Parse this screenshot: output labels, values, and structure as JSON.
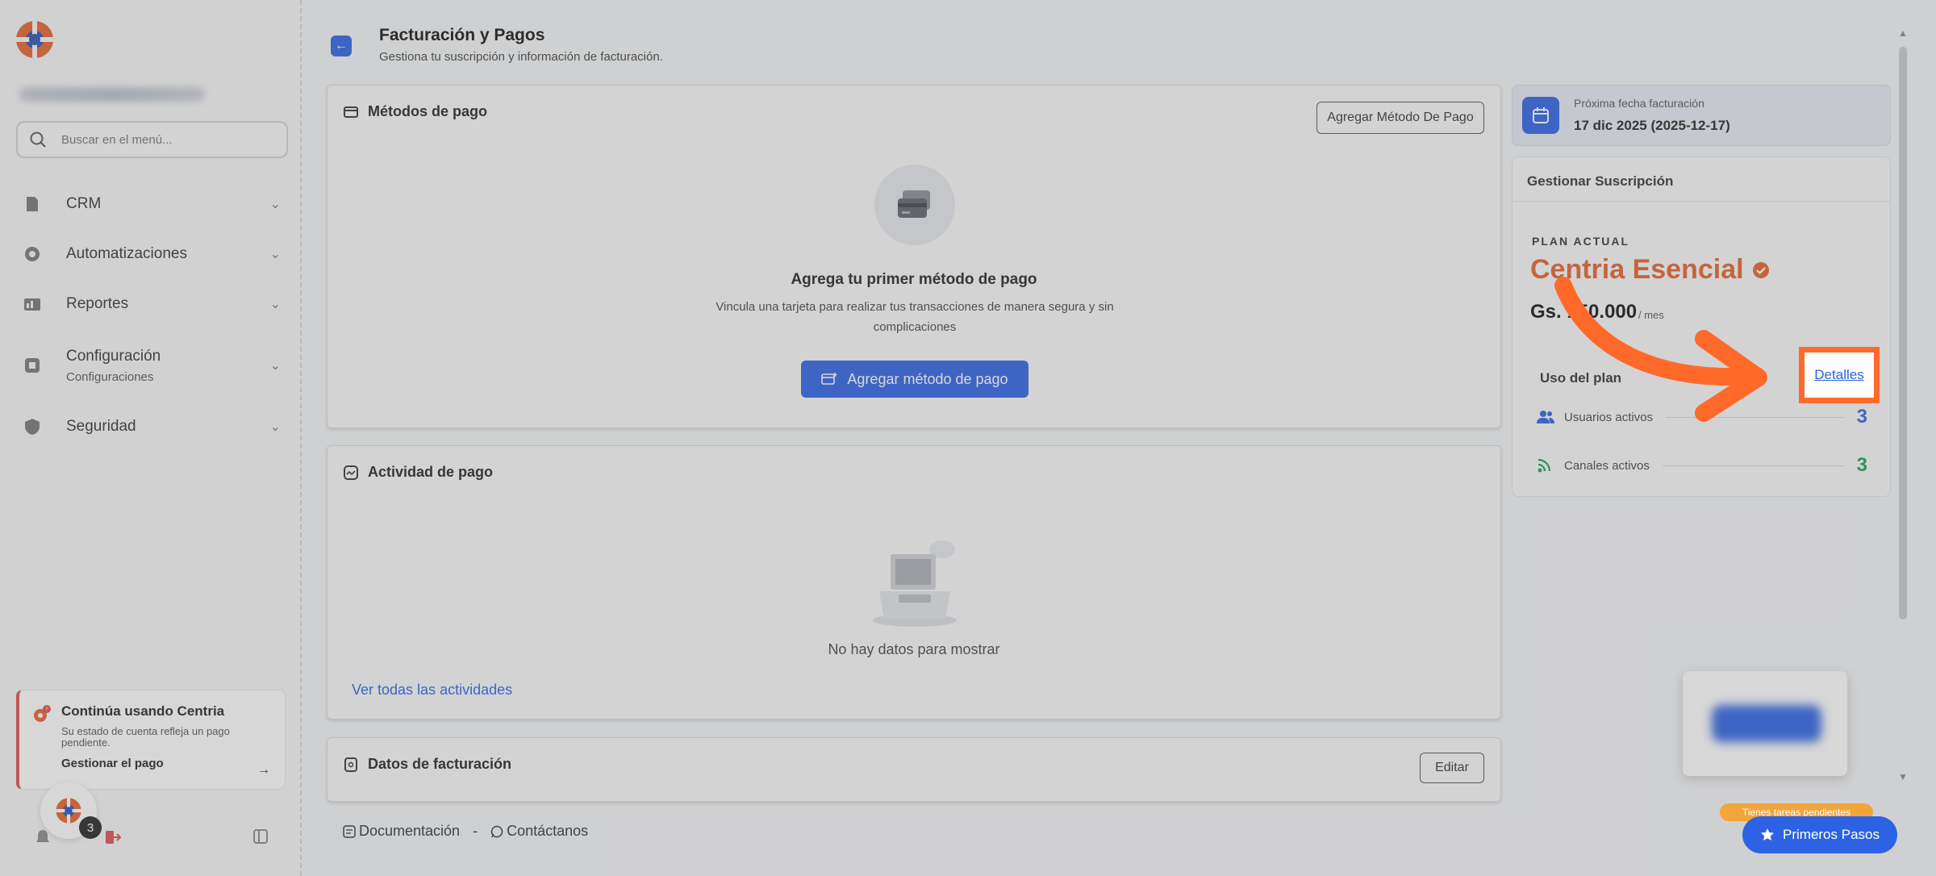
{
  "sidebar": {
    "search": {
      "placeholder": "Buscar en el menú..."
    },
    "items": [
      {
        "label": "CRM",
        "icon": "crm-icon"
      },
      {
        "label": "Automatizaciones",
        "icon": "automation-gear-icon"
      },
      {
        "label": "Reportes",
        "icon": "reports-icon"
      },
      {
        "label": "Configuración",
        "sublabel": "Configuraciones",
        "icon": "settings-icon"
      },
      {
        "label": "Seguridad",
        "icon": "shield-icon"
      }
    ],
    "alert": {
      "title": "Continúa usando Centria",
      "description": "Su estado de cuenta refleja un pago pendiente.",
      "link": "Gestionar el pago"
    },
    "notification_count": "3"
  },
  "header": {
    "title": "Facturación y Pagos",
    "subtitle": "Gestiona tu suscripción y información de facturación."
  },
  "payment_methods": {
    "title": "Métodos de pago",
    "add_button": "Agregar Método De Pago",
    "empty_title": "Agrega tu primer método de pago",
    "empty_description": "Vincula una tarjeta para realizar tus transacciones de manera segura y sin complicaciones",
    "primary_button": "Agregar método de pago"
  },
  "payment_activity": {
    "title": "Actividad de pago",
    "empty_text": "No hay datos para mostrar",
    "see_all": "Ver todas las actividades"
  },
  "billing_data": {
    "title": "Datos de facturación",
    "edit_button": "Editar"
  },
  "footer": {
    "docs": "Documentación",
    "separator": "-",
    "contact": "Contáctanos"
  },
  "next_billing": {
    "label": "Próxima fecha facturación",
    "date": "17 dic 2025 (2025-12-17)"
  },
  "subscription": {
    "header": "Gestionar Suscripción",
    "plan_label": "PLAN ACTUAL",
    "plan_name": "Centria Esencial",
    "price": "Gs. 150.000",
    "period": "/ mes",
    "usage_label": "Uso del plan",
    "details_link": "Detalles",
    "usage": [
      {
        "label": "Usuarios activos",
        "value": "3",
        "color": "#2c62e3"
      },
      {
        "label": "Canales activos",
        "value": "3",
        "color": "#1f9d55"
      }
    ]
  },
  "widgets": {
    "pending_tasks": "Tienes tareas pendientes",
    "first_steps": "Primeros Pasos"
  },
  "colors": {
    "accent": "#2c62e3",
    "plan": "#e5622c",
    "highlight": "#ff6a2b",
    "alert": "#e24b4b"
  }
}
